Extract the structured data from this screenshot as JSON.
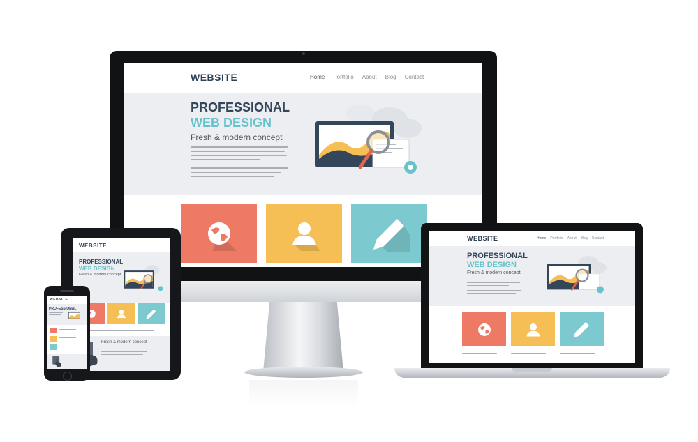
{
  "site": {
    "logo": "WEBSITE",
    "nav": [
      "Home",
      "Portfolio",
      "About",
      "Blog",
      "Contact"
    ],
    "headline_1": "PROFESSIONAL",
    "headline_2": "WEB DESIGN",
    "tagline": "Fresh & modern concept"
  },
  "tiles": [
    {
      "color": "#ee7a66",
      "icon": "globe-icon"
    },
    {
      "color": "#f6bf55",
      "icon": "user-icon"
    },
    {
      "color": "#7cc9cf",
      "icon": "pencil-icon"
    }
  ],
  "colors": {
    "dark_text": "#34465a",
    "accent_teal": "#66c3cb",
    "hero_bg": "#eceef1"
  }
}
